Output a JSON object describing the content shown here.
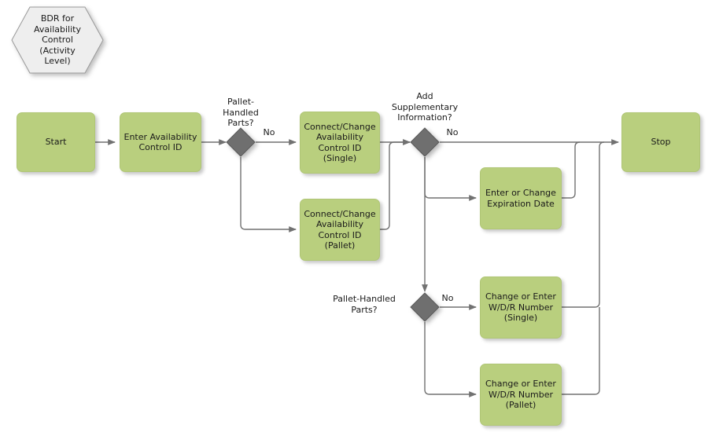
{
  "diagram": {
    "title_hexagon": "BDR for\nAvailability\nControl\n(Activity\nLevel)",
    "colors": {
      "activity_fill": "#b9cf7e",
      "activity_stroke": "#b0c676",
      "decision_fill": "#6f6f6f",
      "decision_stroke": "#595959",
      "hexagon_fill": "#eeeeee",
      "hexagon_stroke": "#999999",
      "edge_stroke": "#717171",
      "text": "#1a1a1a"
    },
    "nodes": {
      "start": "Start",
      "enter_availability_control_id": "Enter Availability\nControl ID",
      "connect_change_single": "Connect/Change\nAvailability\nControl ID\n(Single)",
      "connect_change_pallet": "Connect/Change\nAvailability\nControl ID\n(Pallet)",
      "enter_change_expiration_date": "Enter or Change\nExpiration Date",
      "change_enter_wdr_single": "Change or Enter\nW/D/R Number\n(Single)",
      "change_enter_wdr_pallet": "Change or Enter\nW/D/R Number\n(Pallet)",
      "stop": "Stop"
    },
    "decisions": {
      "pallet_handled_parts_top": "Pallet-\nHandled\nParts?",
      "add_supplementary_information": "Add\nSupplementary\nInformation?",
      "pallet_handled_parts_bottom": "Pallet-Handled\nParts?"
    },
    "edge_labels": {
      "d1_no": "No",
      "d2_no": "No",
      "d3_no": "No"
    }
  }
}
